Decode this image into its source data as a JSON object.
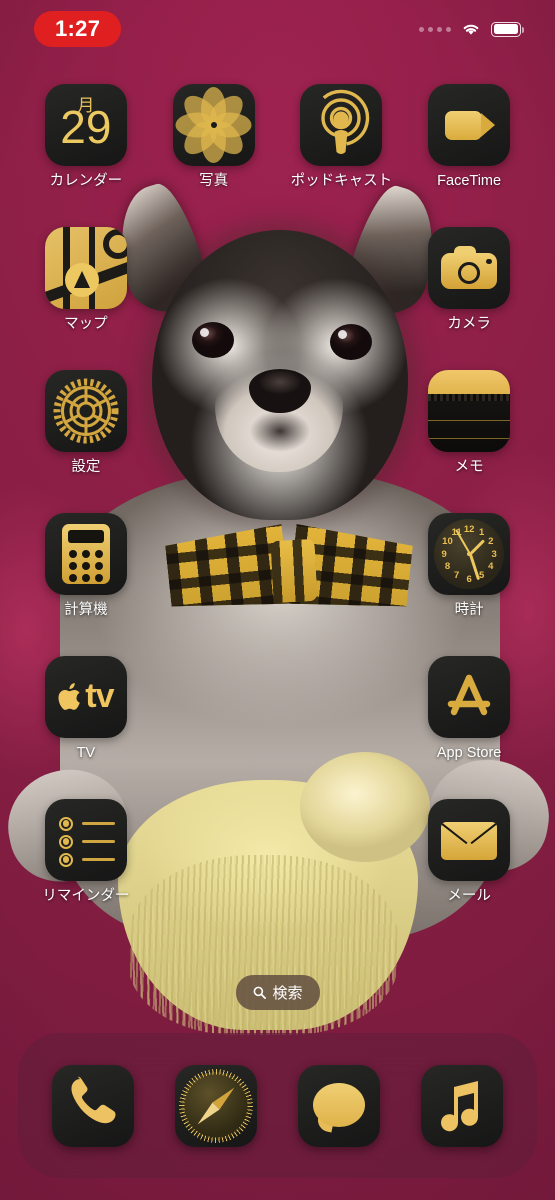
{
  "status_bar": {
    "time": "1:27",
    "time_pill_color": "#e02020",
    "cellular_icon": "cellular-dots-icon",
    "wifi_icon": "wifi-icon",
    "battery_icon": "battery-icon"
  },
  "wallpaper": {
    "description": "photo of a small dog wearing a yellow plaid bow tie with a yellow plush toy",
    "background_color": "#8d1f46"
  },
  "home_screen": {
    "apps": [
      {
        "label": "カレンダー",
        "icon": "calendar-icon",
        "calendar_weekday": "月",
        "calendar_day": "29"
      },
      {
        "label": "写真",
        "icon": "photos-icon"
      },
      {
        "label": "ポッドキャスト",
        "icon": "podcasts-icon"
      },
      {
        "label": "FaceTime",
        "icon": "facetime-icon"
      },
      {
        "label": "マップ",
        "icon": "maps-icon"
      },
      {
        "label": "",
        "icon": ""
      },
      {
        "label": "",
        "icon": ""
      },
      {
        "label": "カメラ",
        "icon": "camera-icon"
      },
      {
        "label": "設定",
        "icon": "settings-icon"
      },
      {
        "label": "",
        "icon": ""
      },
      {
        "label": "",
        "icon": ""
      },
      {
        "label": "メモ",
        "icon": "notes-icon"
      },
      {
        "label": "計算機",
        "icon": "calculator-icon"
      },
      {
        "label": "",
        "icon": ""
      },
      {
        "label": "",
        "icon": ""
      },
      {
        "label": "時計",
        "icon": "clock-icon"
      },
      {
        "label": "TV",
        "icon": "tv-icon",
        "tv_text": "tv"
      },
      {
        "label": "",
        "icon": ""
      },
      {
        "label": "",
        "icon": ""
      },
      {
        "label": "App Store",
        "icon": "app-store-icon"
      },
      {
        "label": "リマインダー",
        "icon": "reminders-icon"
      },
      {
        "label": "",
        "icon": ""
      },
      {
        "label": "",
        "icon": ""
      },
      {
        "label": "メール",
        "icon": "mail-icon"
      }
    ],
    "clock_numerals": [
      "12",
      "1",
      "2",
      "3",
      "4",
      "5",
      "6",
      "7",
      "8",
      "9",
      "10",
      "11"
    ]
  },
  "search": {
    "label": "検索",
    "icon": "search-icon"
  },
  "dock": {
    "apps": [
      {
        "name": "電話",
        "icon": "phone-icon"
      },
      {
        "name": "Safari",
        "icon": "safari-icon"
      },
      {
        "name": "メッセージ",
        "icon": "messages-icon"
      },
      {
        "name": "ミュージック",
        "icon": "music-icon"
      }
    ]
  },
  "theme": {
    "accent_gold": "#e0b84e",
    "icon_dark": "#1a1a1a",
    "wallpaper_crimson": "#8d1f46"
  }
}
